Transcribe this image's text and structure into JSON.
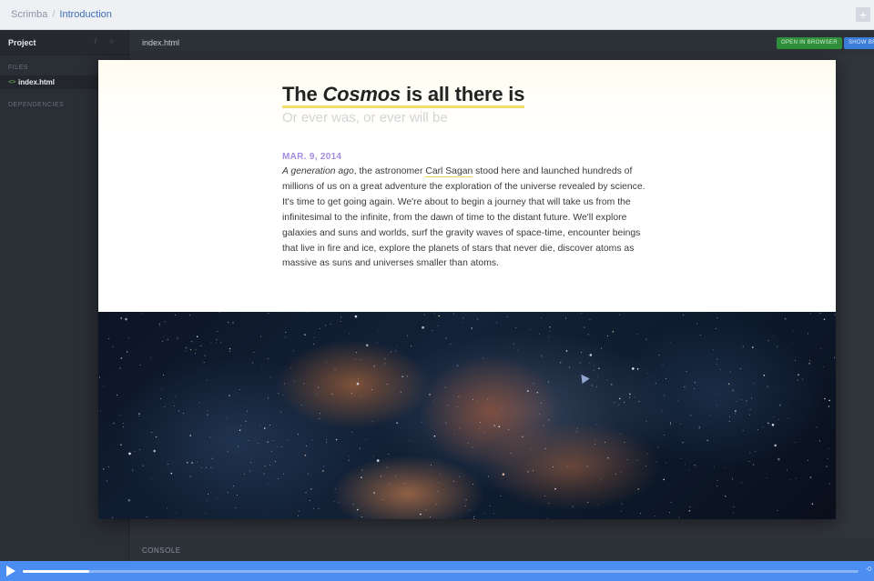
{
  "breadcrumb": {
    "root": "Scrimba",
    "separator": "/",
    "current": "Introduction"
  },
  "topbar": {
    "add_icon": "+"
  },
  "sidebar": {
    "title": "Project",
    "tools": "/ ○",
    "files_label": "FILES",
    "files": [
      {
        "icon": "<>",
        "name": "index.html"
      }
    ],
    "dependencies_label": "DEPENDENCIES"
  },
  "editor": {
    "tab": "index.html",
    "open_in_browser": "OPEN IN BROWSER",
    "show_button": "SHOW BR"
  },
  "preview": {
    "title_start": "The ",
    "title_em": "Cosmos",
    "title_end": " is all there is",
    "subtitle": "Or ever was, or ever will be",
    "date": "MAR. 9, 2014",
    "body_em": "A generation ago",
    "body_a": ", the astronomer ",
    "body_link": "Carl Sagan",
    "body_b": " stood here and launched hundreds of millions of us on a great adventure the exploration of the universe revealed by science. It's time to get going again. We're about to begin a journey that will take us from the infinitesimal to the infinite, from the dawn of time to the distant future. We'll explore galaxies and suns and worlds, surf the gravity waves of space-time, encounter beings that live in fire and ice, explore the planets of stars that never die, discover atoms as massive as suns and universes smaller than atoms."
  },
  "console": {
    "label": "CONSOLE"
  },
  "player": {
    "progress": 0.08,
    "time": "-0"
  },
  "colors": {
    "accent": "#4b8df0",
    "date": "#a48de0",
    "highlight": "#f6dc6a",
    "open_btn": "#2f8f3a"
  }
}
